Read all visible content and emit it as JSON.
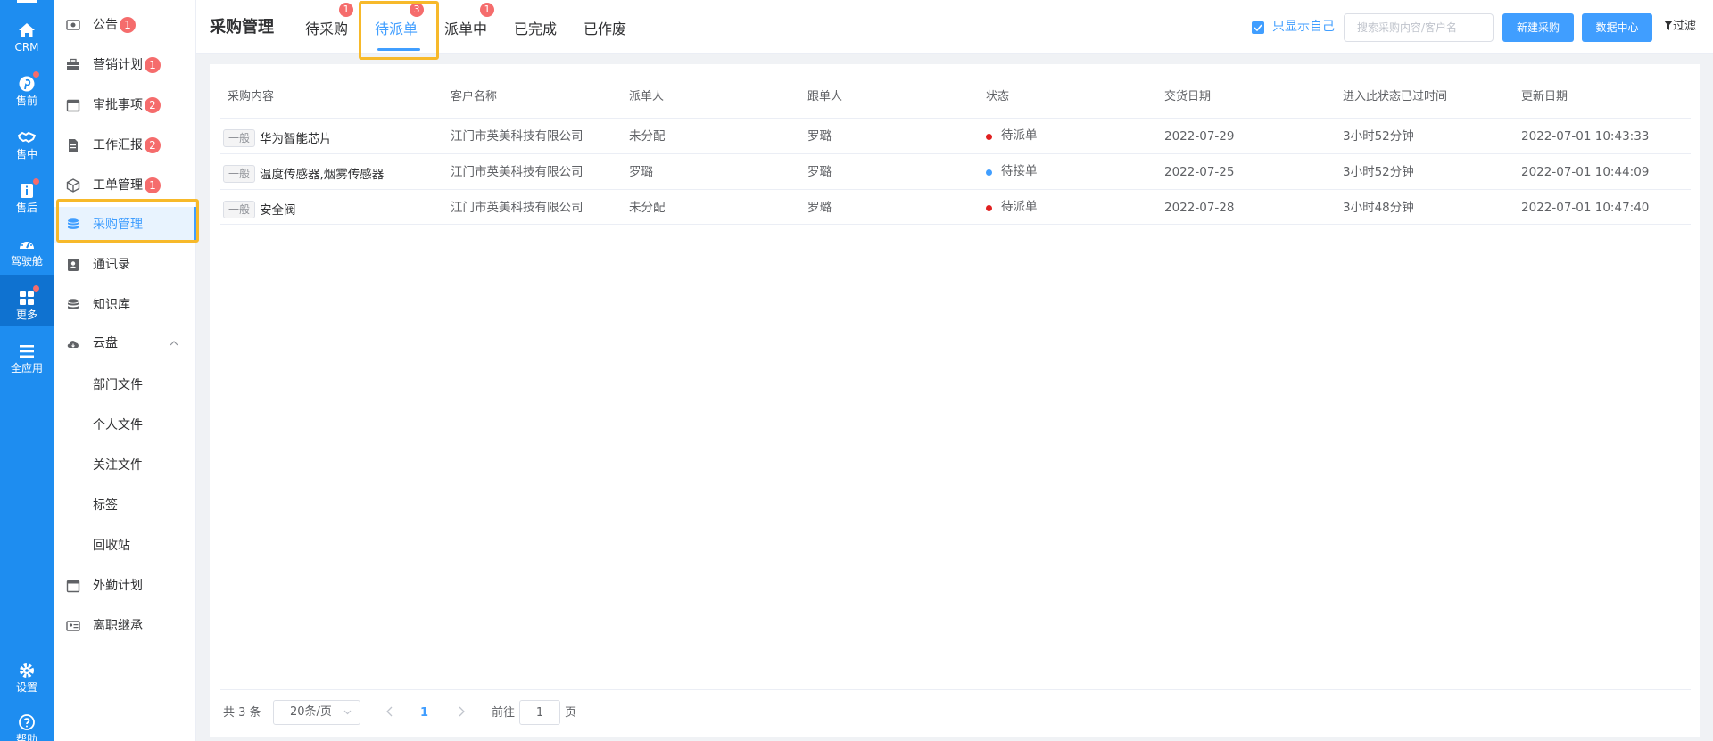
{
  "rail": {
    "items": [
      {
        "label": "CRM",
        "icon": "home-icon"
      },
      {
        "label": "售前",
        "icon": "pinterest-icon",
        "dot": true
      },
      {
        "label": "售中",
        "icon": "handshake-icon"
      },
      {
        "label": "售后",
        "icon": "info-box-icon",
        "dot": true
      },
      {
        "label": "驾驶舱",
        "icon": "dashboard-icon"
      },
      {
        "label": "更多",
        "icon": "grid-icon",
        "dot": true,
        "active": true
      },
      {
        "label": "全应用",
        "icon": "menu-icon"
      }
    ],
    "bottom": [
      {
        "label": "设置",
        "icon": "gear-icon"
      },
      {
        "label": "帮助",
        "icon": "help-icon"
      }
    ]
  },
  "sidebar": {
    "items": [
      {
        "label": "公告",
        "icon": "announcement-icon",
        "badge": "1"
      },
      {
        "label": "营销计划",
        "icon": "briefcase-icon",
        "badge": "1"
      },
      {
        "label": "审批事项",
        "icon": "calendar-icon",
        "badge": "2"
      },
      {
        "label": "工作汇报",
        "icon": "document-icon",
        "badge": "2"
      },
      {
        "label": "工单管理",
        "icon": "box-icon",
        "badge": "1"
      },
      {
        "label": "采购管理",
        "icon": "database-icon",
        "active": true
      },
      {
        "label": "通讯录",
        "icon": "contacts-icon"
      },
      {
        "label": "知识库",
        "icon": "database-icon"
      },
      {
        "label": "云盘",
        "icon": "cloud-icon",
        "expanded": true
      },
      {
        "label": "部门文件",
        "sub": true
      },
      {
        "label": "个人文件",
        "sub": true
      },
      {
        "label": "关注文件",
        "sub": true
      },
      {
        "label": "标签",
        "sub": true
      },
      {
        "label": "回收站",
        "sub": true
      },
      {
        "label": "外勤计划",
        "icon": "calendar-icon"
      },
      {
        "label": "离职继承",
        "icon": "id-card-icon"
      }
    ]
  },
  "header": {
    "title": "采购管理",
    "tabs": [
      {
        "label": "待采购",
        "badge": "1"
      },
      {
        "label": "待派单",
        "badge": "3",
        "active": true
      },
      {
        "label": "派单中",
        "badge": "1"
      },
      {
        "label": "已完成"
      },
      {
        "label": "已作废"
      }
    ],
    "only_self_label": "只显示自己",
    "search_placeholder": "搜索采购内容/客户名",
    "new_button": "新建采购",
    "data_center_button": "数据中心",
    "filter_label": "过滤"
  },
  "table": {
    "columns": [
      "采购内容",
      "客户名称",
      "派单人",
      "跟单人",
      "状态",
      "交货日期",
      "进入此状态已过时间",
      "更新日期"
    ],
    "rows": [
      {
        "tag": "一般",
        "content": "华为智能芯片",
        "customer": "江门市英美科技有限公司",
        "dispatcher": "未分配",
        "follower": "罗璐",
        "status": "待派单",
        "status_color": "#e02020",
        "delivery": "2022-07-29",
        "elapsed": "3小时52分钟",
        "updated": "2022-07-01 10:43:33"
      },
      {
        "tag": "一般",
        "content": "温度传感器,烟雾传感器",
        "customer": "江门市英美科技有限公司",
        "dispatcher": "罗璐",
        "follower": "罗璐",
        "status": "待接单",
        "status_color": "#409eff",
        "delivery": "2022-07-25",
        "elapsed": "3小时52分钟",
        "updated": "2022-07-01 10:44:09"
      },
      {
        "tag": "一般",
        "content": "安全阀",
        "customer": "江门市英美科技有限公司",
        "dispatcher": "未分配",
        "follower": "罗璐",
        "status": "待派单",
        "status_color": "#e02020",
        "delivery": "2022-07-28",
        "elapsed": "3小时48分钟",
        "updated": "2022-07-01 10:47:40"
      }
    ]
  },
  "pagination": {
    "total": "共 3 条",
    "page_size": "20条/页",
    "current": "1",
    "goto_label": "前往",
    "goto_value": "1",
    "goto_unit": "页"
  },
  "colors": {
    "primary": "#409eff",
    "rail": "#1e8df0",
    "badge": "#f56c6c",
    "highlight": "#f7b92a"
  }
}
